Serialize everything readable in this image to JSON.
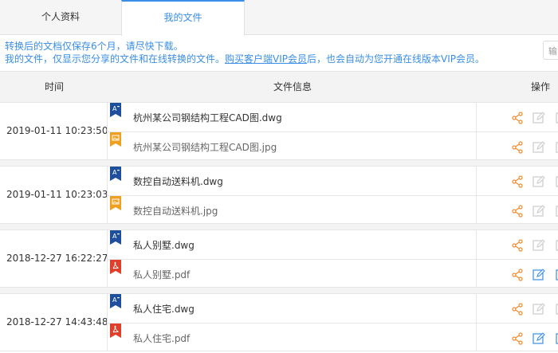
{
  "tabs": [
    {
      "label": "个人资料"
    },
    {
      "label": "我的文件"
    }
  ],
  "notice": {
    "line1": "转换后的文档仅保存6个月，请尽快下载。",
    "line2_prefix": "我的文件，仅显示您分享的文件和在线转换的文件。",
    "line2_link": "购买客户端VIP会员",
    "line2_suffix": "后，也会自动为您开通在线版本VIP会员。"
  },
  "search": {
    "placeholder": "输"
  },
  "table": {
    "headers": {
      "time": "时间",
      "info": "文件信息",
      "action": "操作"
    },
    "groups": [
      {
        "time": "2019-01-11 10:23:50",
        "files": [
          {
            "name": "杭州某公司钢结构工程CAD图.dwg",
            "icon": "dwg-file-icon"
          },
          {
            "name": "杭州某公司钢结构工程CAD图.jpg",
            "icon": "image-file-icon"
          }
        ]
      },
      {
        "time": "2019-01-11 10:23:03",
        "files": [
          {
            "name": "数控自动送料机.dwg",
            "icon": "dwg-file-icon"
          },
          {
            "name": "数控自动送料机.jpg",
            "icon": "image-file-icon"
          }
        ]
      },
      {
        "time": "2018-12-27 16:22:27",
        "files": [
          {
            "name": "私人别墅.dwg",
            "icon": "dwg-file-icon"
          },
          {
            "name": "私人别墅.pdf",
            "icon": "pdf-file-icon"
          }
        ]
      },
      {
        "time": "2018-12-27 14:43:48",
        "files": [
          {
            "name": "私人住宅.dwg",
            "icon": "dwg-file-icon"
          },
          {
            "name": "私人住宅.pdf",
            "icon": "pdf-file-icon"
          }
        ]
      }
    ]
  },
  "colors": {
    "accent": "#3a8ee6",
    "share": "#f08c2c",
    "dwg": "#1e4f9c",
    "image": "#f0a020",
    "pdf": "#e0402b"
  }
}
